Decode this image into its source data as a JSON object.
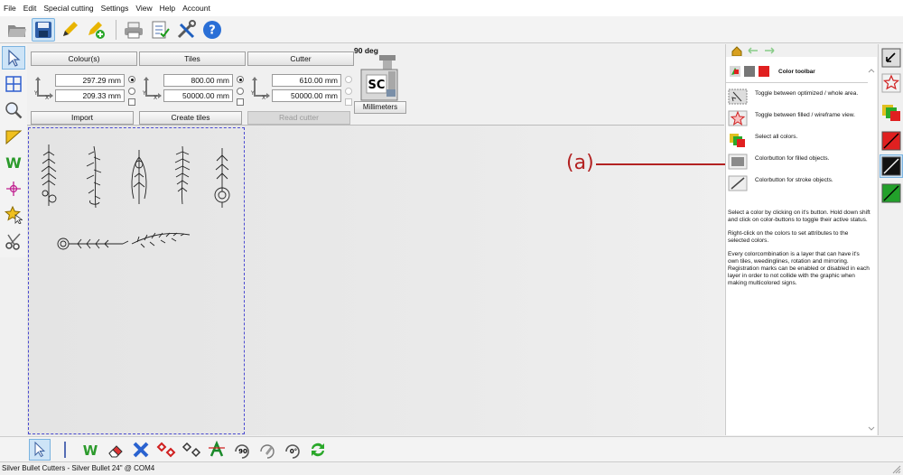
{
  "menu": [
    "File",
    "Edit",
    "Special cutting",
    "Settings",
    "View",
    "Help",
    "Account"
  ],
  "colours": {
    "label": "Colour(s)",
    "width": "297.29 mm",
    "height": "209.33 mm",
    "button": "Import"
  },
  "tiles": {
    "label": "Tiles",
    "width": "800.00 mm",
    "height": "50000.00 mm",
    "button": "Create tiles"
  },
  "cutter": {
    "label": "Cutter",
    "width": "610.00 mm",
    "height": "50000.00 mm",
    "button": "Read cutter"
  },
  "device": {
    "rotation_label": "90 deg",
    "logo_text": "SC",
    "units_button": "Millimeters"
  },
  "axes": {
    "x": "X",
    "y": "Y"
  },
  "doc_panel": {
    "title": "Color toolbar",
    "items": [
      {
        "icon": "optimize-view-icon",
        "text": "Toggle between optimized / whole area."
      },
      {
        "icon": "star-wireframe-icon",
        "text": "Toggle between filled / wireframe view."
      },
      {
        "icon": "all-colors-icon",
        "text": "Select all colors."
      },
      {
        "icon": "fill-color-button-icon",
        "text": "Colorbutton for filled objects."
      },
      {
        "icon": "stroke-color-button-icon",
        "text": "Colorbutton for stroke objects."
      }
    ],
    "paragraphs": [
      "Select a color by clicking on it's button. Hold down shift and click on color-buttons to toggle their active status.",
      "Right-click on the colors to set attributes to the selected colors.",
      "Every colorcombination is a layer that can have it's own tiles, weedinglines, rotation and mirroring. Registration marks can be enabled or disabled in each layer in order to not collide with the graphic when making multicolored signs."
    ]
  },
  "annotation": {
    "label": "(a)",
    "color": "#b32222"
  },
  "bottom_toolbar": {
    "weed_letter": "W",
    "rotate90": "90",
    "rotate0": "0°"
  },
  "status": {
    "text": "Silver Bullet Cutters - Silver Bullet 24\" @ COM4"
  },
  "colors": {
    "accent": "#7ab3e0",
    "red": "#e02020",
    "green": "#22a02a",
    "sheet_border": "#4b4bd1"
  }
}
